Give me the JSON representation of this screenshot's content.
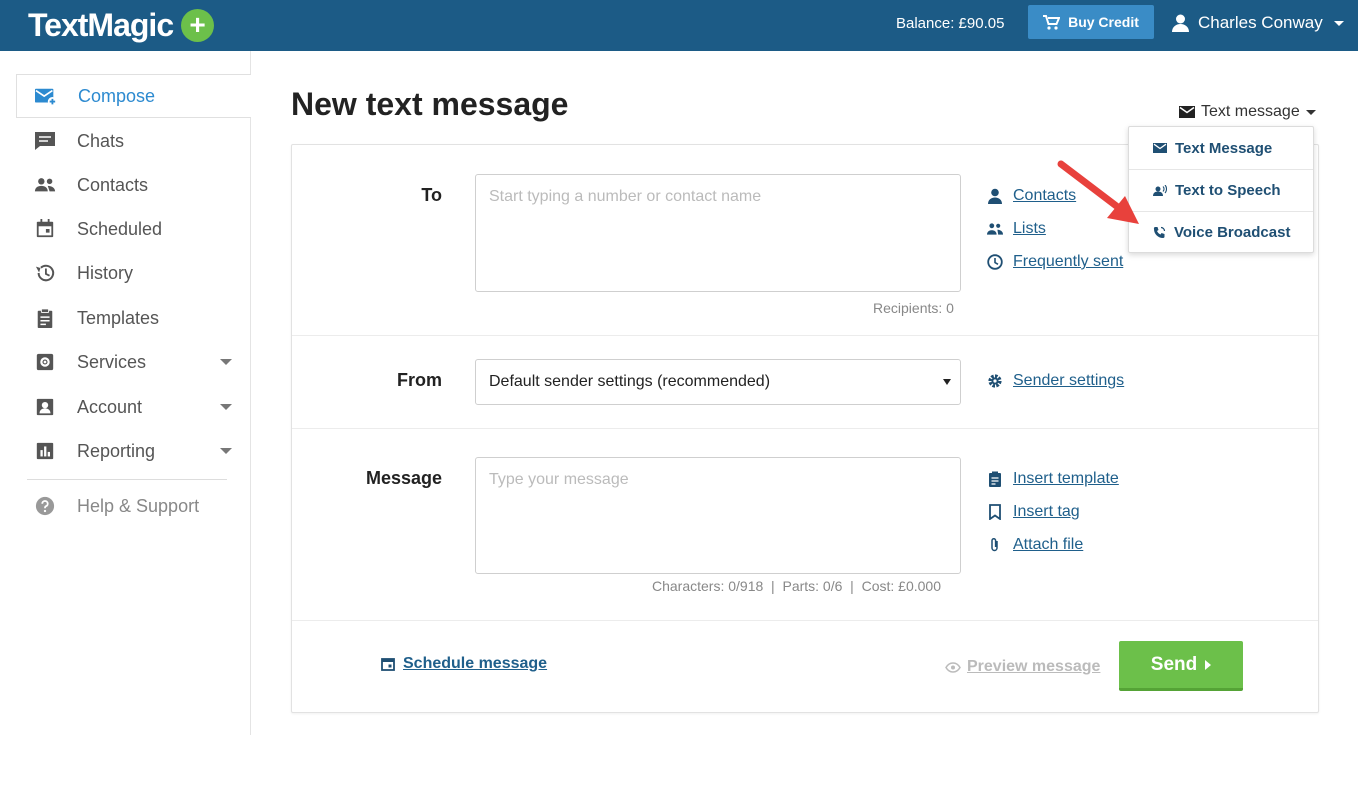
{
  "header": {
    "logo_text": "TextMagic",
    "logo_plus": "+",
    "balance": "Balance: £90.05",
    "buy_credit": "Buy Credit",
    "user_name": "Charles Conway"
  },
  "sidebar": {
    "items": [
      {
        "label": "Compose",
        "icon": "compose-icon",
        "active": true
      },
      {
        "label": "Chats",
        "icon": "chat-icon"
      },
      {
        "label": "Contacts",
        "icon": "contacts-icon"
      },
      {
        "label": "Scheduled",
        "icon": "calendar-icon"
      },
      {
        "label": "History",
        "icon": "history-icon"
      },
      {
        "label": "Templates",
        "icon": "clipboard-icon"
      },
      {
        "label": "Services",
        "icon": "services-icon",
        "expandable": true
      },
      {
        "label": "Account",
        "icon": "account-icon",
        "expandable": true
      },
      {
        "label": "Reporting",
        "icon": "chart-icon",
        "expandable": true
      }
    ],
    "help": {
      "label": "Help & Support",
      "icon": "help-icon"
    }
  },
  "main": {
    "title": "New text message",
    "message_type": "Text message"
  },
  "form": {
    "to_label": "To",
    "to_placeholder": "Start typing a number or contact name",
    "recipients": "Recipients: 0",
    "to_links": [
      "Contacts",
      "Lists",
      "Frequently sent"
    ],
    "from_label": "From",
    "from_value": "Default sender settings (recommended)",
    "sender_settings": "Sender settings",
    "message_label": "Message",
    "message_placeholder": "Type your message",
    "message_links": [
      "Insert template",
      "Insert tag",
      "Attach file"
    ],
    "stats": "Characters: 0/918  |  Parts: 0/6  |  Cost: £0.000",
    "schedule": "Schedule message",
    "preview": "Preview message",
    "send": "Send"
  },
  "dropdown": {
    "items": [
      "Text Message",
      "Text to Speech",
      "Voice Broadcast"
    ]
  },
  "colors": {
    "header_bg": "#1c5b86",
    "accent_green": "#6cc04a",
    "link_blue": "#1f5f8b",
    "annotation_red": "#e8413c"
  }
}
